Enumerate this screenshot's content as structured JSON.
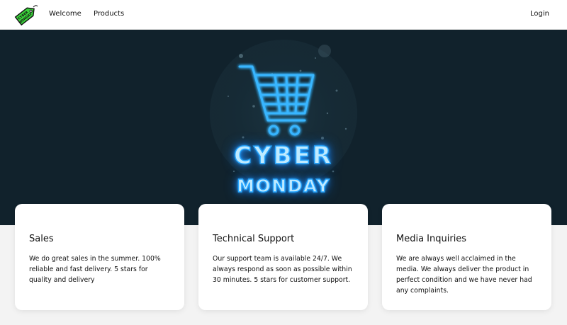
{
  "navbar": {
    "logo_icon": "cyber-monday-price-tag-icon",
    "logo_text": "CYBER MONDAY",
    "welcome_label": "Welcome",
    "products_label": "Products",
    "login_label": "Login"
  },
  "hero": {
    "icon": "shopping-cart-neon-icon",
    "line1": "CYBER",
    "line2": "MONDAY",
    "background_color": "#11222c",
    "neon_color": "#27a6ff"
  },
  "cards": [
    {
      "title": "Sales",
      "body": "We do great sales in the summer. 100% reliable and fast delivery. 5 stars for quality and delivery"
    },
    {
      "title": "Technical Support",
      "body": "Our support team is available 24/7. We always respond as soon as possible within 30 minutes. 5 stars for customer support."
    },
    {
      "title": "Media Inquiries",
      "body": "We are always well acclaimed in the media. We always deliver the product in perfect condition and we have never had any complaints."
    }
  ]
}
